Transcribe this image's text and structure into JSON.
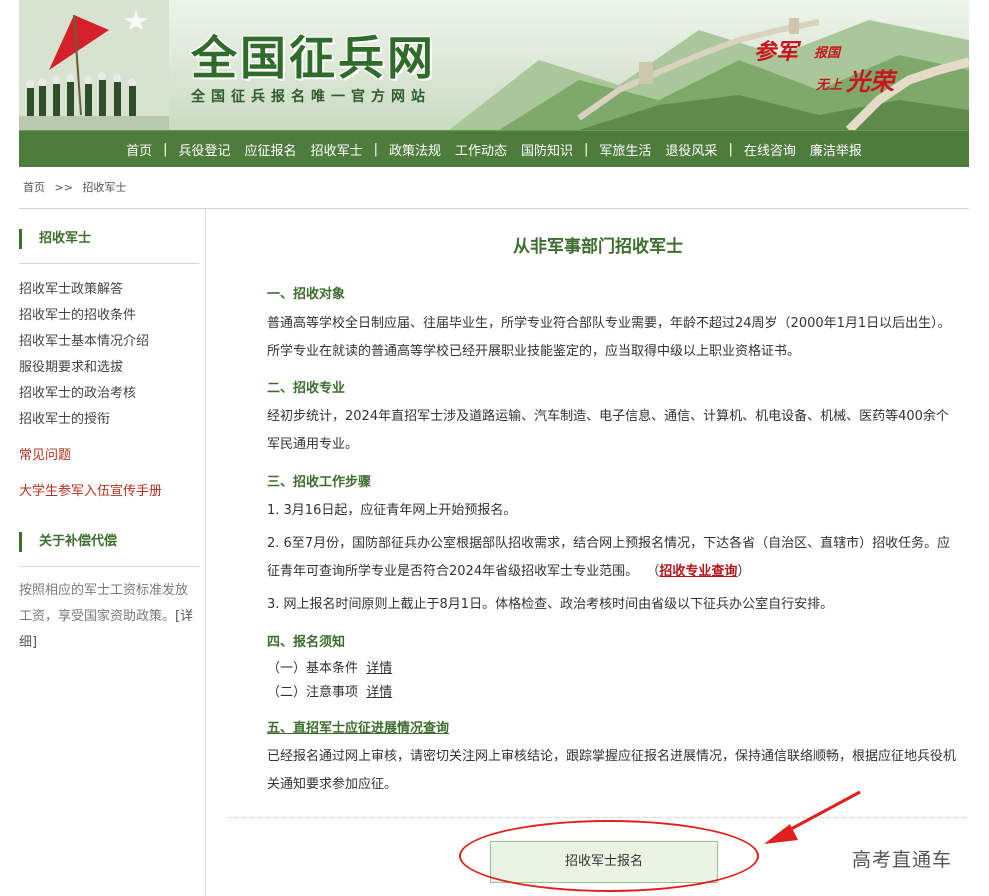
{
  "header": {
    "site_title": "全国征兵网",
    "site_subtitle": "全国征兵报名唯一官方网站",
    "slogan": {
      "part1": "参军",
      "part2": "报国",
      "part3": "无上",
      "part4": "光荣"
    }
  },
  "nav": {
    "items": [
      "首页",
      "兵役登记",
      "应征报名",
      "招收军士",
      "政策法规",
      "工作动态",
      "国防知识",
      "军旅生活",
      "退役风采",
      "在线咨询",
      "廉洁举报"
    ],
    "separator": "|"
  },
  "breadcrumb": {
    "home": "首页",
    "separator": ">>",
    "current": "招收军士"
  },
  "sidebar": {
    "section1_title": "招收军士",
    "links": [
      "招收军士政策解答",
      "招收军士的招收条件",
      "招收军士基本情况介绍",
      "服役期要求和选拔",
      "招收军士的政治考核",
      "招收军士的授衔"
    ],
    "faq": "常见问题",
    "brochure": "大学生参军入伍宣传手册",
    "section2_title": "关于补偿代偿",
    "section2_text": "按照相应的军士工资标准发放工资，享受国家资助政策。",
    "detail_link": "[详细]"
  },
  "main": {
    "title": "从非军事部门招收军士",
    "s1": {
      "heading": "一、招收对象",
      "text": "普通高等学校全日制应届、往届毕业生，所学专业符合部队专业需要，年龄不超过24周岁（2000年1月1日以后出生）。所学专业在就读的普通高等学校已经开展职业技能鉴定的，应当取得中级以上职业资格证书。"
    },
    "s2": {
      "heading": "二、招收专业",
      "text": "经初步统计，2024年直招军士涉及道路运输、汽车制造、电子信息、通信、计算机、机电设备、机械、医药等400余个军民通用专业。"
    },
    "s3": {
      "heading": "三、招收工作步骤",
      "step1": "1. 3月16日起，应征青年网上开始预报名。",
      "step2": "2. 6至7月份，国防部征兵办公室根据部队招收需求，结合网上预报名情况，下达各省（自治区、直辖市）招收任务。应征青年可查询所学专业是否符合2024年省级招收军士专业范围。",
      "query_open": "（",
      "query_link": "招收专业查询",
      "query_close": "）",
      "step3": "3. 网上报名时间原则上截止于8月1日。体格检查、政治考核时间由省级以下征兵办公室自行安排。"
    },
    "s4": {
      "heading": "四、报名须知",
      "item1": "（一）基本条件",
      "item2": "（二）注意事项",
      "detail": "详情"
    },
    "s5": {
      "heading": "五、直招军士应征进展情况查询",
      "text": "已经报名通过网上审核，请密切关注网上审核结论，跟踪掌握应征报名进展情况，保持通信联络顺畅，根据应征地兵役机关通知要求参加应征。"
    },
    "register_button": "招收军士报名"
  },
  "watermark": "高考直通车",
  "colors": {
    "nav_bg": "#4d7c3c",
    "heading_green": "#3d6e2d",
    "link_red": "#b7131b",
    "annotation_red": "#e0201f",
    "button_bg": "#ebf4e4"
  }
}
